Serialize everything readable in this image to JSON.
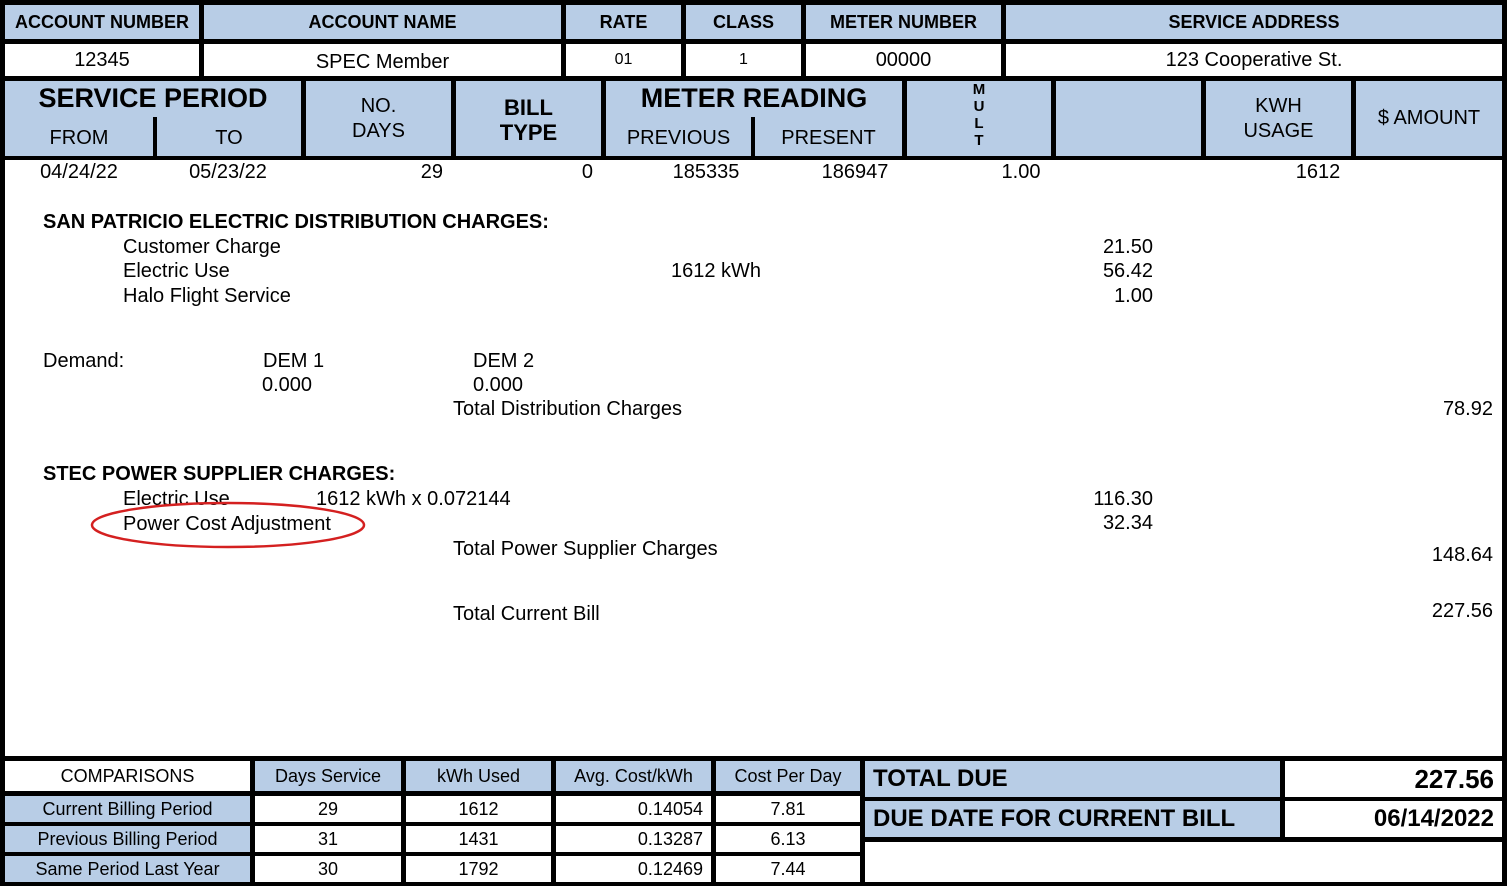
{
  "account_header": {
    "account_number_label": "ACCOUNT NUMBER",
    "account_name_label": "ACCOUNT NAME",
    "rate_label": "RATE",
    "class_label": "CLASS",
    "meter_number_label": "METER NUMBER",
    "service_address_label": "SERVICE ADDRESS",
    "account_number": "12345",
    "account_name": "SPEC Member",
    "rate": "01",
    "class": "1",
    "meter_number": "00000",
    "service_address": "123 Cooperative St."
  },
  "reading_header": {
    "service_period": "SERVICE PERIOD",
    "from": "FROM",
    "to": "TO",
    "no": "NO.",
    "days": "DAYS",
    "bill": "BILL",
    "type": "TYPE",
    "meter_reading": "METER READING",
    "previous": "PREVIOUS",
    "present": "PRESENT",
    "mult": [
      "M",
      "U",
      "L",
      "T"
    ],
    "kwh": "KWH",
    "usage": "USAGE",
    "amount": "$ AMOUNT"
  },
  "reading_row": {
    "from": "04/24/22",
    "to": "05/23/22",
    "days": "29",
    "bill_type": "0",
    "previous": "185335",
    "present": "186947",
    "mult": "1.00",
    "kwh_usage": "1612"
  },
  "distribution": {
    "title": "SAN PATRICIO ELECTRIC DISTRIBUTION CHARGES:",
    "customer_charge_label": "Customer Charge",
    "customer_charge": "21.50",
    "electric_use_label": "Electric Use",
    "electric_use_kwh": "1612 kWh",
    "electric_use": "56.42",
    "halo_label": "Halo Flight Service",
    "halo": "1.00",
    "demand_label": "Demand:",
    "dem1_label": "DEM 1",
    "dem1_value": "0.000",
    "dem2_label": "DEM 2",
    "dem2_value": "0.000",
    "total_label": "Total Distribution Charges",
    "total": "78.92"
  },
  "supplier": {
    "title": "STEC POWER SUPPLIER CHARGES:",
    "electric_use_label": "Electric Use",
    "electric_use_calc": "1612 kWh x 0.072144",
    "electric_use": "116.30",
    "pca_label": "Power Cost Adjustment",
    "pca": "32.34",
    "total_label": "Total Power Supplier Charges",
    "total": "148.64"
  },
  "current_bill": {
    "label": "Total Current Bill",
    "amount": "227.56"
  },
  "comparisons": {
    "headers": [
      "COMPARISONS",
      "Days Service",
      "kWh Used",
      "Avg. Cost/kWh",
      "Cost Per Day"
    ],
    "rows": [
      {
        "label": "Current Billing Period",
        "days": "29",
        "kwh": "1612",
        "avg": "0.14054",
        "per_day": "7.81"
      },
      {
        "label": "Previous Billing Period",
        "days": "31",
        "kwh": "1431",
        "avg": "0.13287",
        "per_day": "6.13"
      },
      {
        "label": "Same Period Last Year",
        "days": "30",
        "kwh": "1792",
        "avg": "0.12469",
        "per_day": "7.44"
      }
    ]
  },
  "totals": {
    "total_due_label": "TOTAL DUE",
    "total_due": "227.56",
    "due_date_label": "DUE DATE FOR CURRENT BILL",
    "due_date": "06/14/2022"
  },
  "colors": {
    "header_blue": "#b8cde6",
    "border": "#000000",
    "annotation_red": "#d42020"
  }
}
